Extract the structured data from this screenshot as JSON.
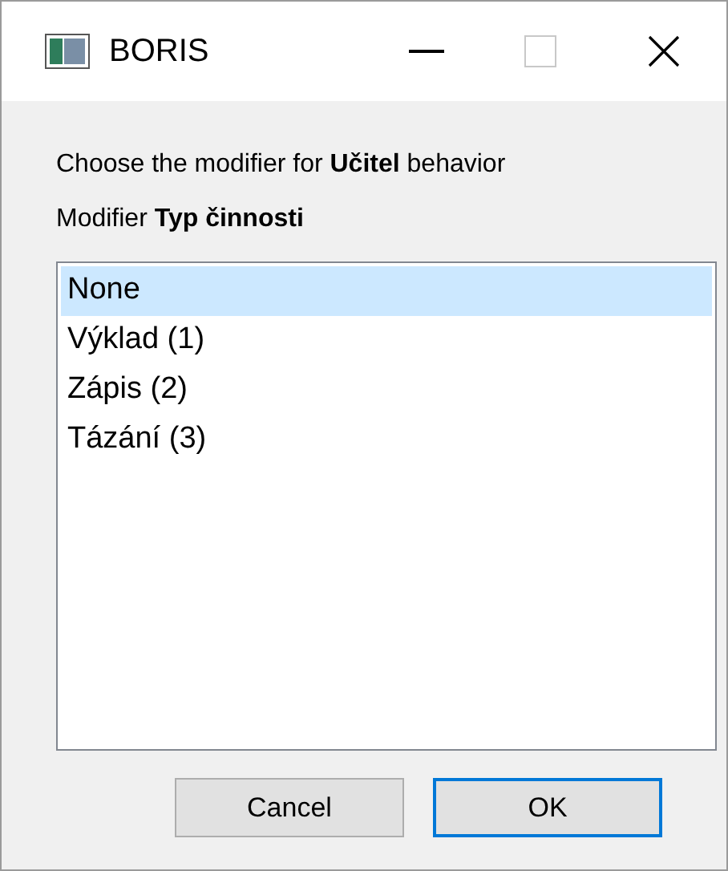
{
  "window": {
    "title": "BORIS"
  },
  "prompt": "Choose the modifier for **Učitel** behavior",
  "modifier_label": "Modifier **Typ činnosti**",
  "items": [
    {
      "label": "None",
      "selected": true
    },
    {
      "label": "Výklad (1)",
      "selected": false
    },
    {
      "label": "Zápis (2)",
      "selected": false
    },
    {
      "label": "Tázání (3)",
      "selected": false
    }
  ],
  "buttons": [
    {
      "label": "Cancel",
      "default": false
    },
    {
      "label": "OK",
      "default": true
    }
  ]
}
